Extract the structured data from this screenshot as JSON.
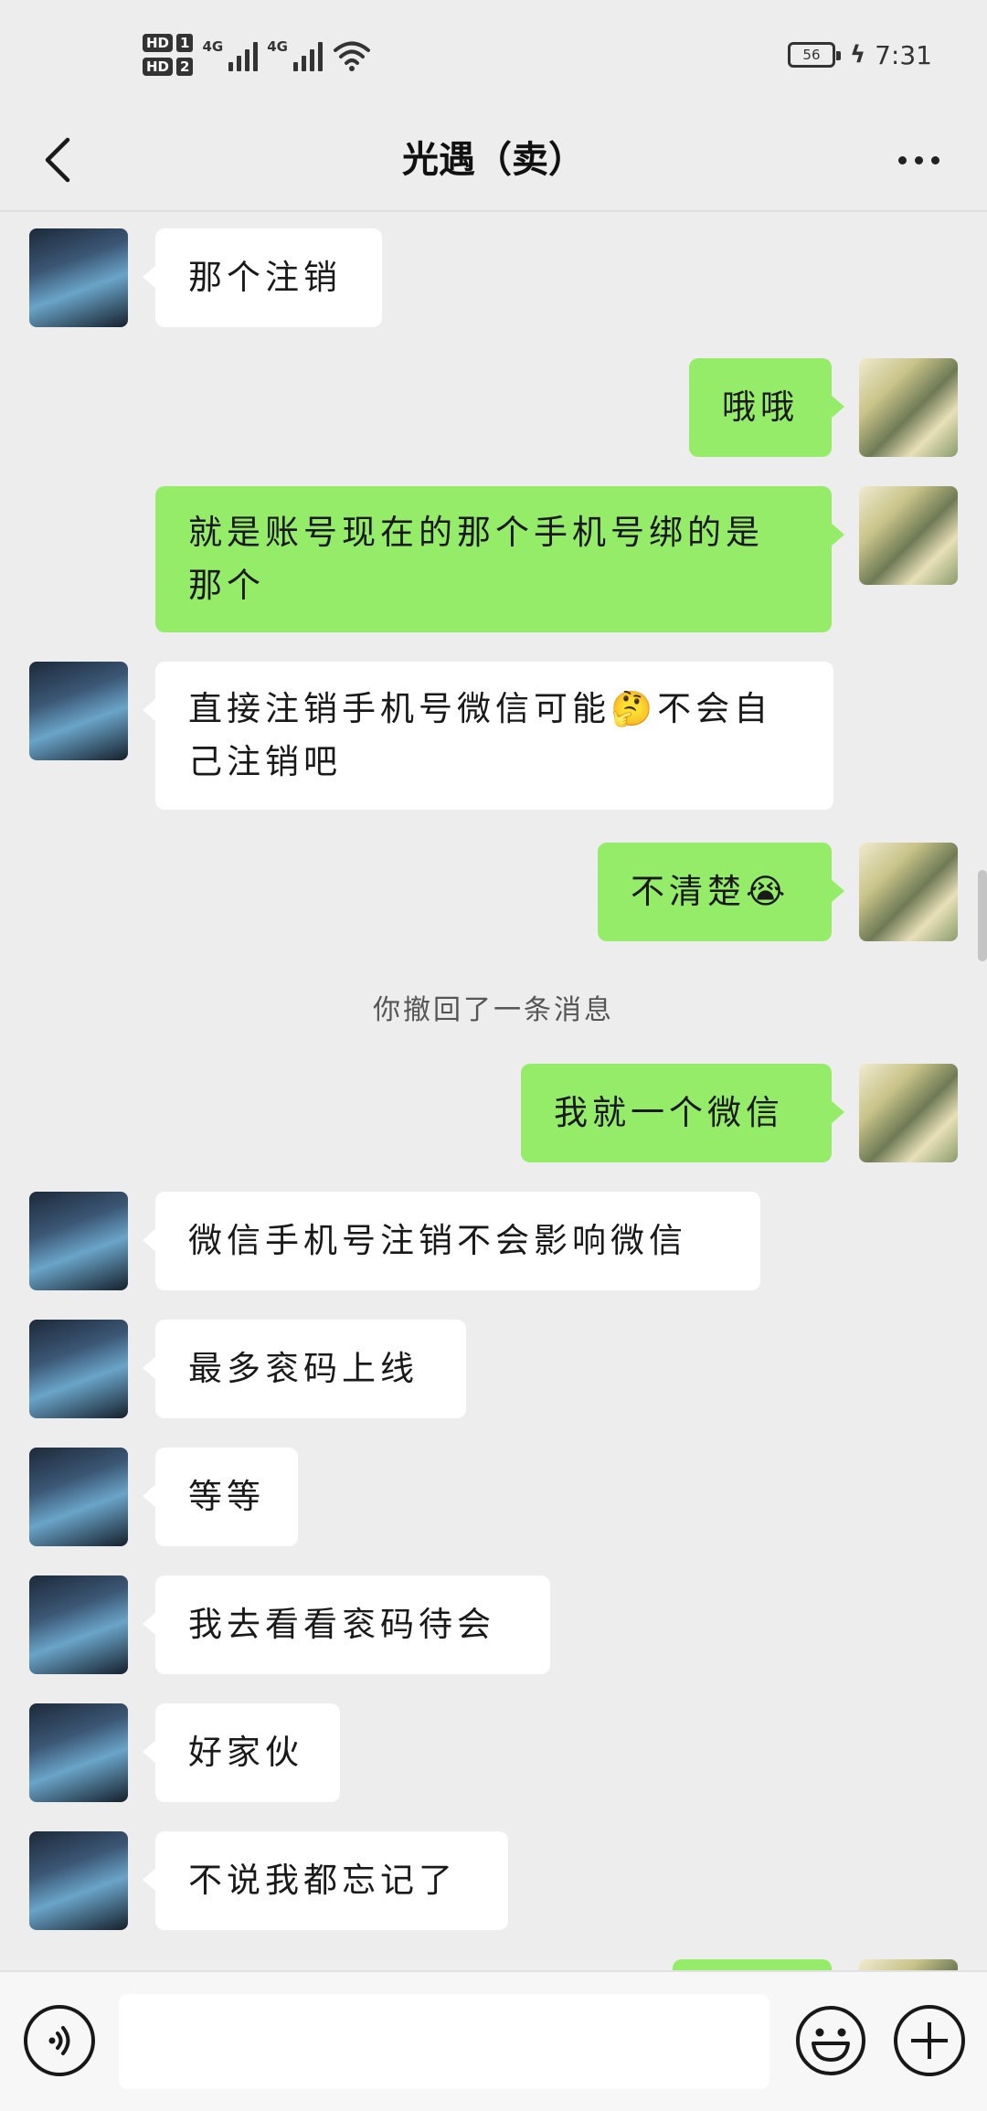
{
  "status_bar": {
    "hd1": "HD",
    "sim1": "1",
    "hd2": "HD",
    "sim2": "2",
    "net1": "4G",
    "net2": "4G",
    "battery": "56",
    "time": "7:31"
  },
  "header": {
    "title": "光遇（卖）"
  },
  "messages": [
    {
      "from": "them",
      "text": "那个注销"
    },
    {
      "from": "me",
      "text": "哦哦"
    },
    {
      "from": "me",
      "text": "就是账号现在的那个手机号绑的是那个"
    },
    {
      "from": "them",
      "text": "直接注销手机号微信可能🤔不会自己注销吧"
    },
    {
      "from": "me",
      "text": "不清楚😭"
    },
    {
      "from": "system",
      "text": "你撤回了一条消息"
    },
    {
      "from": "me",
      "text": "我就一个微信"
    },
    {
      "from": "them",
      "text": "微信手机号注销不会影响微信"
    },
    {
      "from": "them",
      "text": "最多衮码上线"
    },
    {
      "from": "them",
      "text": "等等"
    },
    {
      "from": "them",
      "text": "我去看看衮码待会"
    },
    {
      "from": "them",
      "text": "好家伙"
    },
    {
      "from": "them",
      "text": "不说我都忘记了"
    }
  ],
  "input": {
    "value": ""
  },
  "icons": {
    "back": "back-arrow-icon",
    "more": "more-icon",
    "voice": "voice-icon",
    "emoji": "emoji-icon",
    "plus": "plus-icon"
  }
}
